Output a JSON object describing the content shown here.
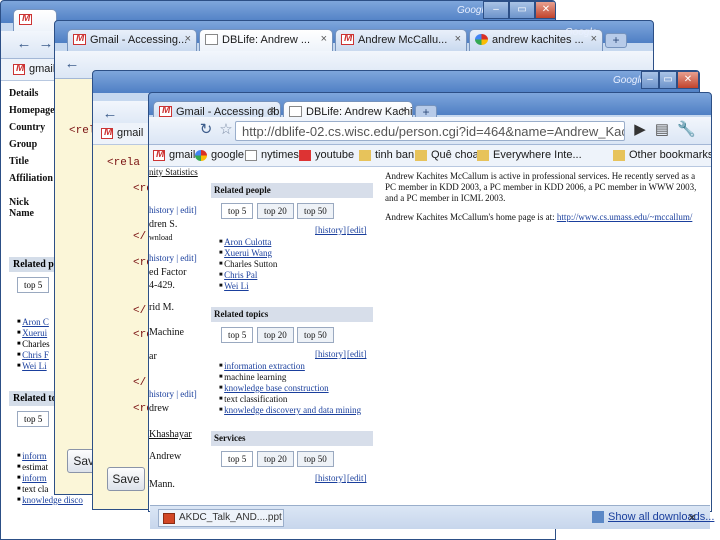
{
  "windows": {
    "back": {
      "brand": "Google",
      "toolbar_text": "gmail"
    },
    "middle": {
      "brand": "Google",
      "tabs": [
        "Gmail - Accessing...",
        "DBLife: Andrew ...",
        "Andrew McCallu...",
        "andrew kachites ..."
      ],
      "new_tab": "+",
      "toolbar_text": "gmail",
      "save_label": "Save"
    },
    "front": {
      "brand": "Google",
      "tabs": [
        "Gmail - Accessing dbli...",
        "DBLife: Andrew Kachi...",
        "Andrew McCallu...",
        "andrew kachites ..."
      ],
      "new_tab": "+",
      "url": "http://dblife-02.cs.wisc.edu/person.cgi?id=464&name=Andrew_Kachites_McCall",
      "toolbar_text": "gmail",
      "save_label": "Save",
      "bookmarks": [
        "gmail",
        "google",
        "nytimes",
        "youtube",
        "tinh ban",
        "Quê choa",
        "Everywhere Inte...",
        "Other bookmarks"
      ]
    }
  },
  "left_profile": {
    "labels": [
      "Details",
      "Homepage",
      "Country",
      "Group",
      "Title",
      "Affiliation",
      "",
      "Nick Name"
    ],
    "related_people_header": "Related peo",
    "tab_top5": "top 5",
    "people": [
      "Aron C",
      "Xuerui",
      "Charles",
      "Chris F",
      "Wei Li"
    ],
    "related_topics_header": "Related top",
    "topics": [
      "inform",
      "estimat",
      "inform",
      "text cla",
      "knowledge disco"
    ]
  },
  "xml_left": [
    "<rel",
    "<rela"
  ],
  "xml_mid": {
    "lines": [
      "<relate",
      "<re",
      "</",
      "<re",
      "</",
      "<re",
      "</",
      "<re"
    ],
    "fragments": [
      "more",
      "nity Statistics",
      "history | edit]",
      "dren S.",
      "wnload",
      "history | edit]",
      "ed Factor",
      "4-429.",
      "rid M.",
      "Machine",
      "ar",
      "history | edit]",
      "drew",
      "Khashayar",
      "Andrew",
      "Mann."
    ]
  },
  "dblife": {
    "related_people": {
      "header": "Related people",
      "tabs": [
        "top 5",
        "top 20",
        "top 50"
      ],
      "history": "[history]",
      "edit": "[edit]",
      "items": [
        "Aron Culotta",
        "Xuerui Wang",
        "Charles Sutton",
        "Chris Pal",
        "Wei Li"
      ]
    },
    "related_topics": {
      "header": "Related topics",
      "tabs": [
        "top 5",
        "top 20",
        "top 50"
      ],
      "history": "[history]",
      "edit": "[edit]",
      "items": [
        "information extraction",
        "machine learning",
        "knowledge base construction",
        "text classification",
        "knowledge discovery and data mining"
      ]
    },
    "services": {
      "header": "Services",
      "tabs": [
        "top 5",
        "top 20",
        "top 50"
      ],
      "history": "[history]",
      "edit": "[edit]"
    },
    "description": "Andrew Kachites McCallum is active in professional services. He recently served as a PC member in KDD 2003, a PC member in KDD 2006, a PC member in WWW 2003, and a PC member in ICML 2003.",
    "homepage_prefix": "Andrew Kachites McCallum's home page is at:",
    "homepage_url": "http://www.cs.umass.edu/~mccallum/"
  },
  "downloads": {
    "item": "AKDC_Talk_AND....ppt",
    "show_all": "Show all downloads...",
    "close": "×"
  }
}
